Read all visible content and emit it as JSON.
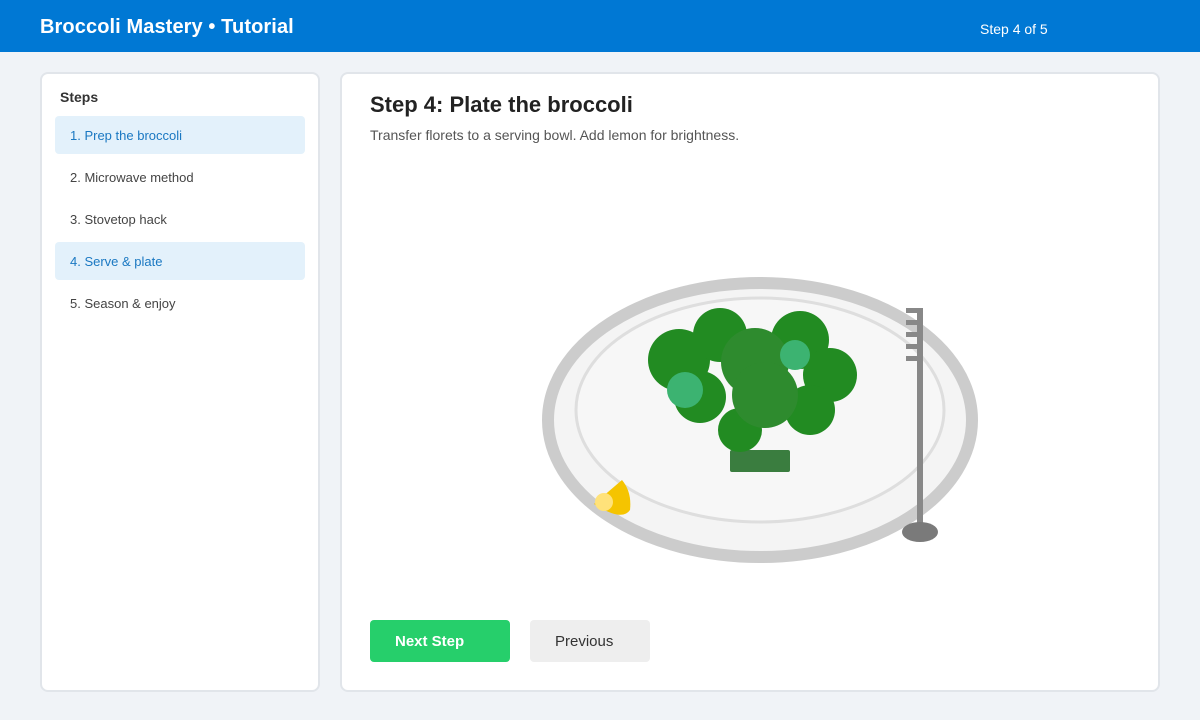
{
  "header": {
    "title": "Broccoli Mastery • Tutorial",
    "step_counter": "Step 4 of 5"
  },
  "sidebar": {
    "heading": "Steps",
    "items": [
      {
        "label": "1. Prep the broccoli",
        "highlighted": true
      },
      {
        "label": "2. Microwave method",
        "highlighted": false
      },
      {
        "label": "3. Stovetop hack",
        "highlighted": false
      },
      {
        "label": "4. Serve & plate",
        "highlighted": true
      },
      {
        "label": "5. Season & enjoy",
        "highlighted": false
      }
    ]
  },
  "main": {
    "title": "Step 4: Plate the broccoli",
    "description": "Transfer florets to a serving bowl. Add lemon for brightness.",
    "illustration": {
      "icons": [
        "plate-icon",
        "broccoli-icon",
        "fork-icon",
        "lemon-wedge-icon"
      ]
    },
    "next_label": "Next Step",
    "prev_label": "Previous"
  },
  "colors": {
    "header_bg": "#0078d4",
    "accent": "#1a78c2",
    "active_item_bg": "#e3f1fb",
    "next_button": "#26cf6b",
    "broccoli": "#228b22",
    "lemon": "#f5c400"
  }
}
